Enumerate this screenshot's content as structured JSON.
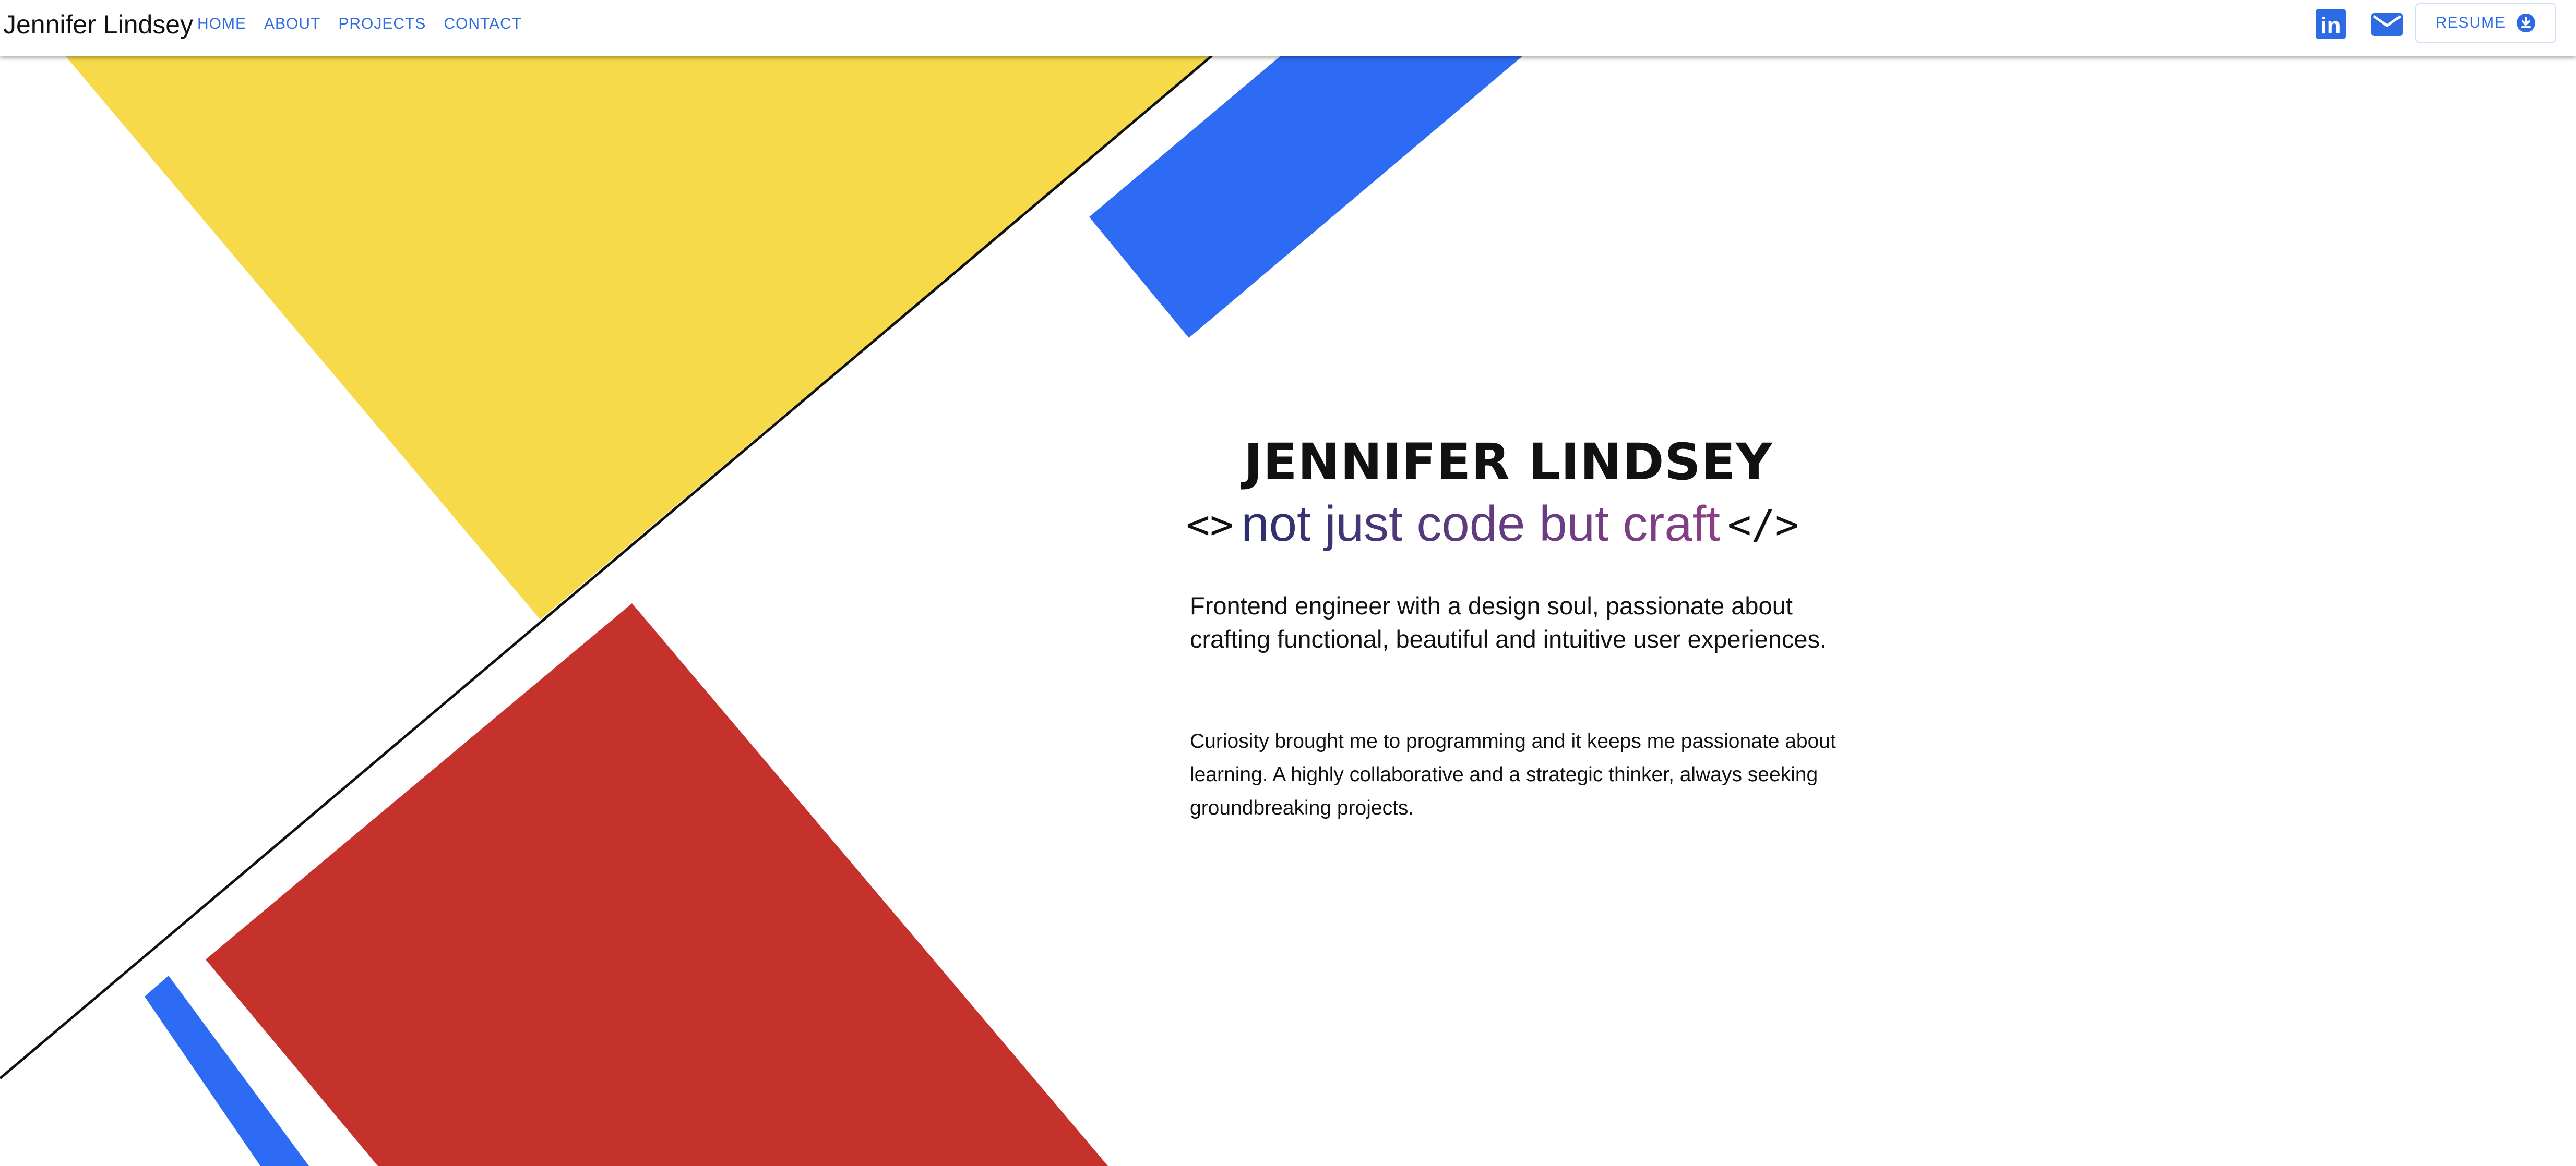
{
  "header": {
    "brand": "Jennifer Lindsey",
    "nav": [
      "HOME",
      "ABOUT",
      "PROJECTS",
      "CONTACT"
    ],
    "social": [
      {
        "icon": "linkedin-icon",
        "label": "in"
      },
      {
        "icon": "mail-icon"
      }
    ],
    "resume_label": "RESUME",
    "resume_icon": "download-icon"
  },
  "hero": {
    "name": "JENNIFER LINDSEY",
    "tag_open": "<>",
    "tagline": "not just code but craft",
    "tag_close": "</>",
    "intro": "Frontend engineer with a design soul, passionate about crafting functional, beautiful and intuitive user experiences.",
    "bio": "Curiosity brought me to programming and it keeps me passionate about learning. A highly collaborative and a strategic thinker, always seeking groundbreaking projects."
  },
  "colors": {
    "accent": "#2d6be4",
    "yellow": "#f7da4a",
    "blue": "#2d6bf4",
    "red": "#c4322b",
    "gradient_start": "#2a2e6b",
    "gradient_end": "#8b3f86"
  }
}
